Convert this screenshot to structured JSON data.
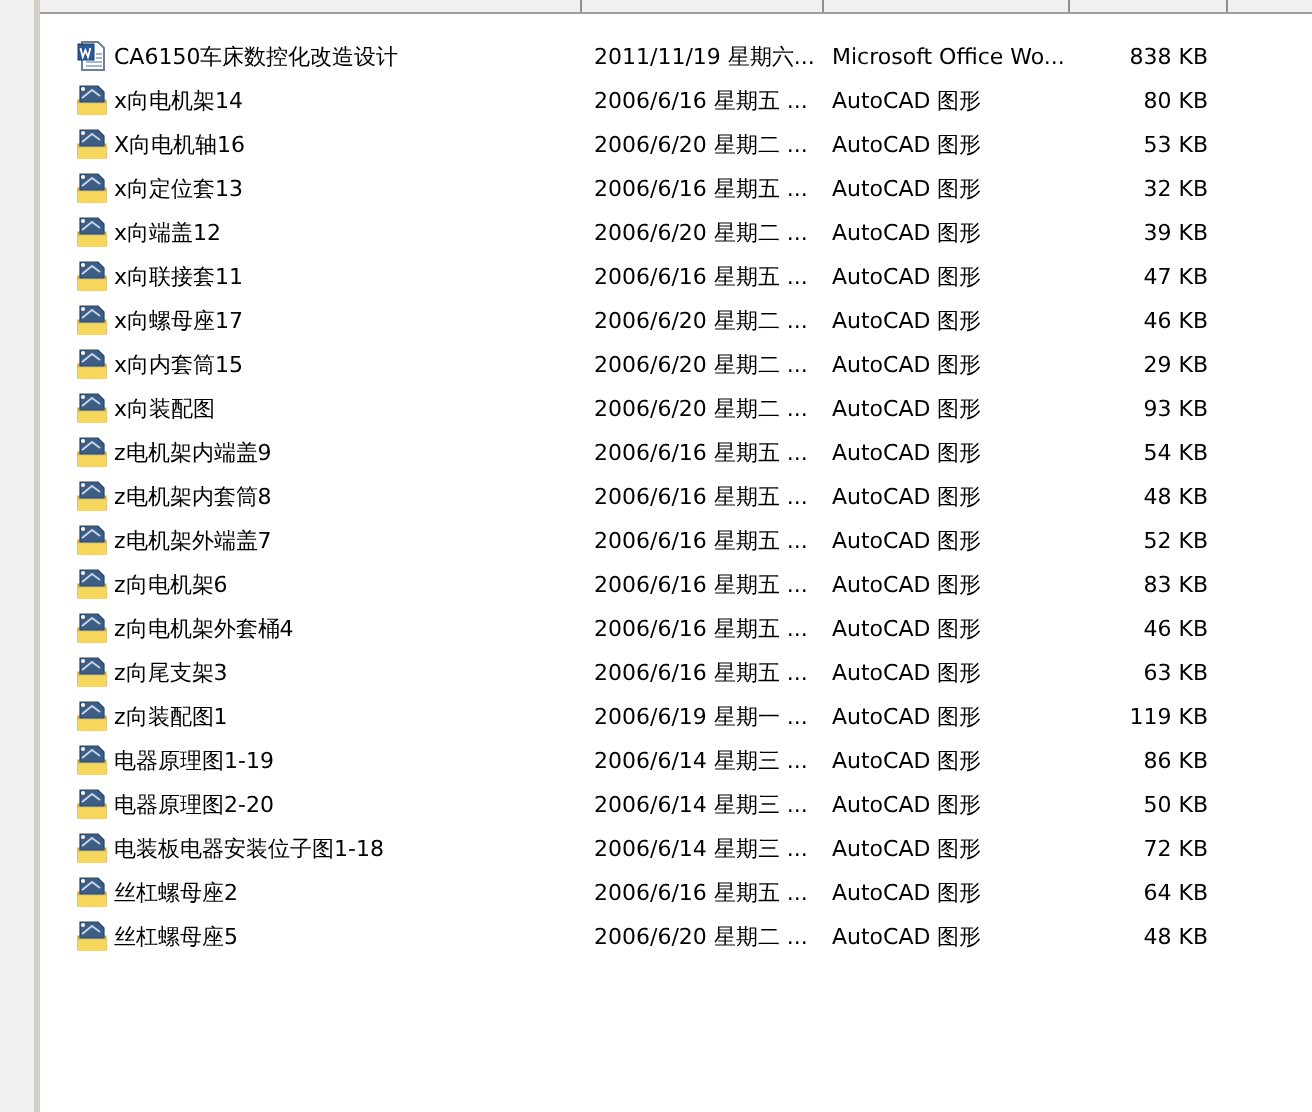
{
  "files": [
    {
      "kind": "word",
      "name": "CA6150车床数控化改造设计",
      "date": "2011/11/19 星期六...",
      "type": "Microsoft Office Wo...",
      "size": "838 KB"
    },
    {
      "kind": "cad",
      "name": "x向电机架14",
      "date": "2006/6/16 星期五 ...",
      "type": "AutoCAD 图形",
      "size": "80 KB"
    },
    {
      "kind": "cad",
      "name": "X向电机轴16",
      "date": "2006/6/20 星期二 ...",
      "type": "AutoCAD 图形",
      "size": "53 KB"
    },
    {
      "kind": "cad",
      "name": "x向定位套13",
      "date": "2006/6/16 星期五 ...",
      "type": "AutoCAD 图形",
      "size": "32 KB"
    },
    {
      "kind": "cad",
      "name": "x向端盖12",
      "date": "2006/6/20 星期二 ...",
      "type": "AutoCAD 图形",
      "size": "39 KB"
    },
    {
      "kind": "cad",
      "name": "x向联接套11",
      "date": "2006/6/16 星期五 ...",
      "type": "AutoCAD 图形",
      "size": "47 KB"
    },
    {
      "kind": "cad",
      "name": "x向螺母座17",
      "date": "2006/6/20 星期二 ...",
      "type": "AutoCAD 图形",
      "size": "46 KB"
    },
    {
      "kind": "cad",
      "name": "x向内套筒15",
      "date": "2006/6/20 星期二 ...",
      "type": "AutoCAD 图形",
      "size": "29 KB"
    },
    {
      "kind": "cad",
      "name": "x向装配图",
      "date": "2006/6/20 星期二 ...",
      "type": "AutoCAD 图形",
      "size": "93 KB"
    },
    {
      "kind": "cad",
      "name": "z电机架内端盖9",
      "date": "2006/6/16 星期五 ...",
      "type": "AutoCAD 图形",
      "size": "54 KB"
    },
    {
      "kind": "cad",
      "name": "z电机架内套筒8",
      "date": "2006/6/16 星期五 ...",
      "type": "AutoCAD 图形",
      "size": "48 KB"
    },
    {
      "kind": "cad",
      "name": "z电机架外端盖7",
      "date": "2006/6/16 星期五 ...",
      "type": "AutoCAD 图形",
      "size": "52 KB"
    },
    {
      "kind": "cad",
      "name": "z向电机架6",
      "date": "2006/6/16 星期五 ...",
      "type": "AutoCAD 图形",
      "size": "83 KB"
    },
    {
      "kind": "cad",
      "name": "z向电机架外套桶4",
      "date": "2006/6/16 星期五 ...",
      "type": "AutoCAD 图形",
      "size": "46 KB"
    },
    {
      "kind": "cad",
      "name": "z向尾支架3",
      "date": "2006/6/16 星期五 ...",
      "type": "AutoCAD 图形",
      "size": "63 KB"
    },
    {
      "kind": "cad",
      "name": "z向装配图1",
      "date": "2006/6/19 星期一 ...",
      "type": "AutoCAD 图形",
      "size": "119 KB"
    },
    {
      "kind": "cad",
      "name": "电器原理图1-19",
      "date": "2006/6/14 星期三 ...",
      "type": "AutoCAD 图形",
      "size": "86 KB"
    },
    {
      "kind": "cad",
      "name": "电器原理图2-20",
      "date": "2006/6/14 星期三 ...",
      "type": "AutoCAD 图形",
      "size": "50 KB"
    },
    {
      "kind": "cad",
      "name": "电装板电器安装位子图1-18",
      "date": "2006/6/14 星期三 ...",
      "type": "AutoCAD 图形",
      "size": "72 KB"
    },
    {
      "kind": "cad",
      "name": "丝杠螺母座2",
      "date": "2006/6/16 星期五 ...",
      "type": "AutoCAD 图形",
      "size": "64 KB"
    },
    {
      "kind": "cad",
      "name": "丝杠螺母座5",
      "date": "2006/6/20 星期二 ...",
      "type": "AutoCAD 图形",
      "size": "48 KB"
    }
  ]
}
